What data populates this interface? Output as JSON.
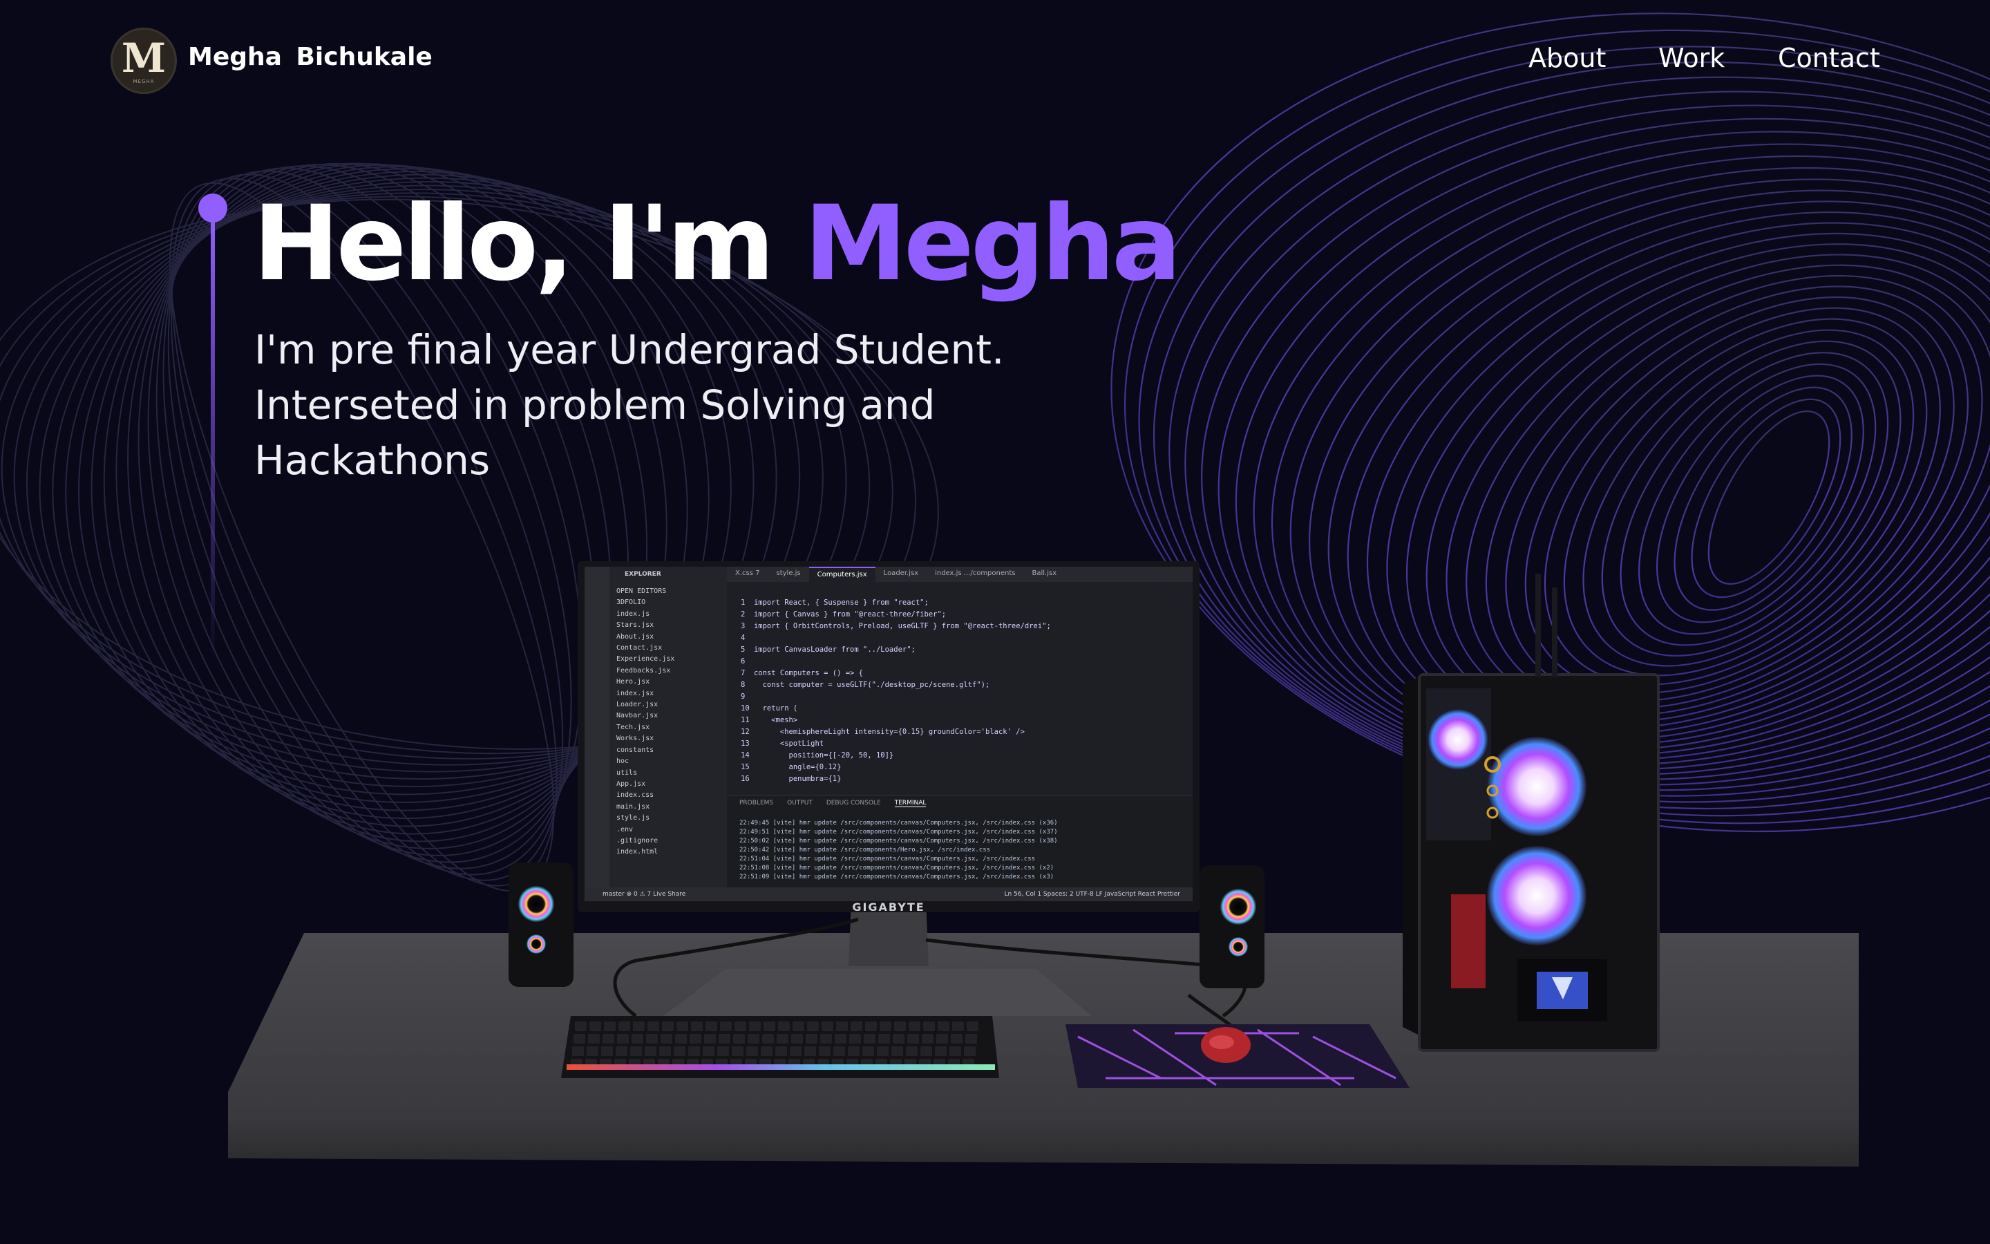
{
  "brand": {
    "logo_letter": "M",
    "logo_small": "MEGHA",
    "name": "Megha Bichukale"
  },
  "nav": {
    "links": [
      "About",
      "Work",
      "Contact"
    ]
  },
  "hero": {
    "greeting": "Hello, I'm ",
    "name": "Megha",
    "subtitle_lines": [
      "I'm pre final year Undergrad Student.",
      "Interseted in problem Solving and",
      "Hackathons"
    ]
  },
  "colors": {
    "background": "#080818",
    "accent": "#915eff",
    "text": "#ffffff"
  },
  "editor": {
    "explorer_title": "EXPLORER",
    "tabs": [
      "X.css 7",
      "style.js",
      "Computers.jsx",
      "Loader.jsx",
      "index.js .../components",
      "Ball.jsx"
    ],
    "files": [
      "OPEN EDITORS",
      "3DFOLIO",
      "index.js",
      "Stars.jsx",
      "About.jsx",
      "Contact.jsx",
      "Experience.jsx",
      "Feedbacks.jsx",
      "Hero.jsx",
      "index.jsx",
      "Loader.jsx",
      "Navbar.jsx",
      "Tech.jsx",
      "Works.jsx",
      "constants",
      "hoc",
      "utils",
      "App.jsx",
      "index.css",
      "main.jsx",
      "style.js",
      ".env",
      ".gitignore",
      "index.html"
    ],
    "code_lines": [
      "1  import React, { Suspense } from \"react\";",
      "2  import { Canvas } from \"@react-three/fiber\";",
      "3  import { OrbitControls, Preload, useGLTF } from \"@react-three/drei\";",
      "4",
      "5  import CanvasLoader from \"../Loader\";",
      "6",
      "7  const Computers = () => {",
      "8    const computer = useGLTF(\"./desktop_pc/scene.gltf\");",
      "9",
      "10   return (",
      "11     <mesh>",
      "12       <hemisphereLight intensity={0.15} groundColor='black' />",
      "13       <spotLight",
      "14         position={[-20, 50, 10]}",
      "15         angle={0.12}",
      "16         penumbra={1}"
    ],
    "panel_tabs": [
      "PROBLEMS",
      "OUTPUT",
      "DEBUG CONSOLE",
      "TERMINAL"
    ],
    "terminal_lines": [
      "22:49:45 [vite] hmr update /src/components/canvas/Computers.jsx, /src/index.css (x36)",
      "22:49:51 [vite] hmr update /src/components/canvas/Computers.jsx, /src/index.css (x37)",
      "22:50:02 [vite] hmr update /src/components/canvas/Computers.jsx, /src/index.css (x38)",
      "22:50:42 [vite] hmr update /src/components/Hero.jsx, /src/index.css",
      "22:51:04 [vite] hmr update /src/components/canvas/Computers.jsx, /src/index.css",
      "22:51:08 [vite] hmr update /src/components/canvas/Computers.jsx, /src/index.css (x2)",
      "22:51:09 [vite] hmr update /src/components/canvas/Computers.jsx, /src/index.css (x3)"
    ],
    "status_left": "master  ⊗ 0 ⚠ 7  Live Share",
    "status_right": "Ln 56, Col 1  Spaces: 2  UTF-8  LF  JavaScript React  Prettier"
  },
  "monitor_brand": "GIGABYTE"
}
